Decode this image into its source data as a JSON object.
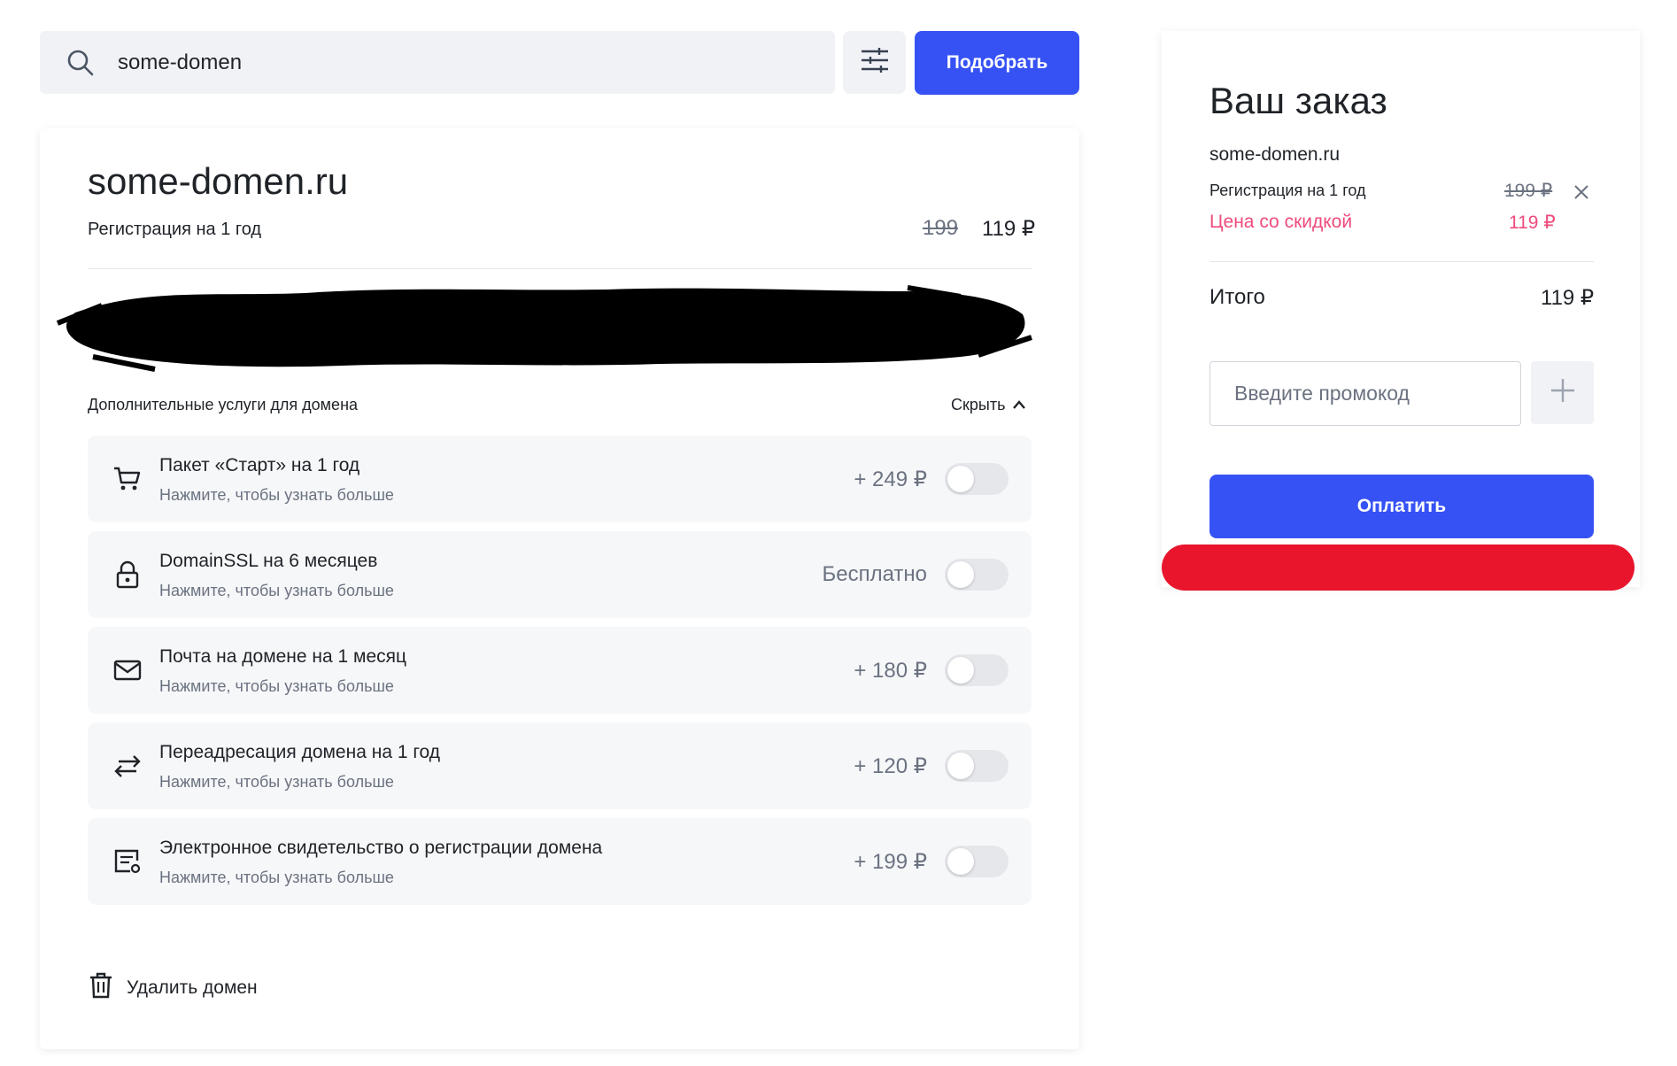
{
  "search": {
    "value": "some-domen",
    "button_label": "Подобрать"
  },
  "domain": {
    "name": "some-domen.ru",
    "registration_label": "Регистрация на 1 год",
    "price_old": "199",
    "price_new": "119 ₽",
    "extra_services_label": "Дополнительные услуги для домена",
    "hide_label": "Скрыть",
    "services": [
      {
        "title": "Пакет «Старт» на 1 год",
        "subtitle": "Нажмите, чтобы узнать больше",
        "price": "+ 249 ₽",
        "icon": "cart-icon",
        "enabled": false
      },
      {
        "title": "DomainSSL на 6 месяцев",
        "subtitle": "Нажмите, чтобы узнать больше",
        "price": "Бесплатно",
        "icon": "lock-icon",
        "enabled": false
      },
      {
        "title": "Почта на домене на 1 месяц",
        "subtitle": "Нажмите, чтобы узнать больше",
        "price": "+ 180 ₽",
        "icon": "mail-icon",
        "enabled": false
      },
      {
        "title": "Переадресация домена на 1 год",
        "subtitle": "Нажмите, чтобы узнать больше",
        "price": "+ 120 ₽",
        "icon": "redirect-arrows-icon",
        "enabled": false
      },
      {
        "title": "Электронное свидетельство о регистрации домена",
        "subtitle": "Нажмите, чтобы узнать больше",
        "price": "+ 199 ₽",
        "icon": "certificate-icon",
        "enabled": false
      }
    ],
    "delete_label": "Удалить домен"
  },
  "order": {
    "title": "Ваш заказ",
    "domain": "some-domen.ru",
    "registration_label": "Регистрация на 1 год",
    "registration_old_price": "199 ₽",
    "discount_label": "Цена со скидкой",
    "discount_price": "119 ₽",
    "total_label": "Итого",
    "total_price": "119 ₽",
    "promo_placeholder": "Введите промокод",
    "pay_label": "Оплатить"
  },
  "colors": {
    "accent": "#3652f5",
    "discount": "#ee4b7c",
    "redaction_bar": "#e8152c"
  }
}
